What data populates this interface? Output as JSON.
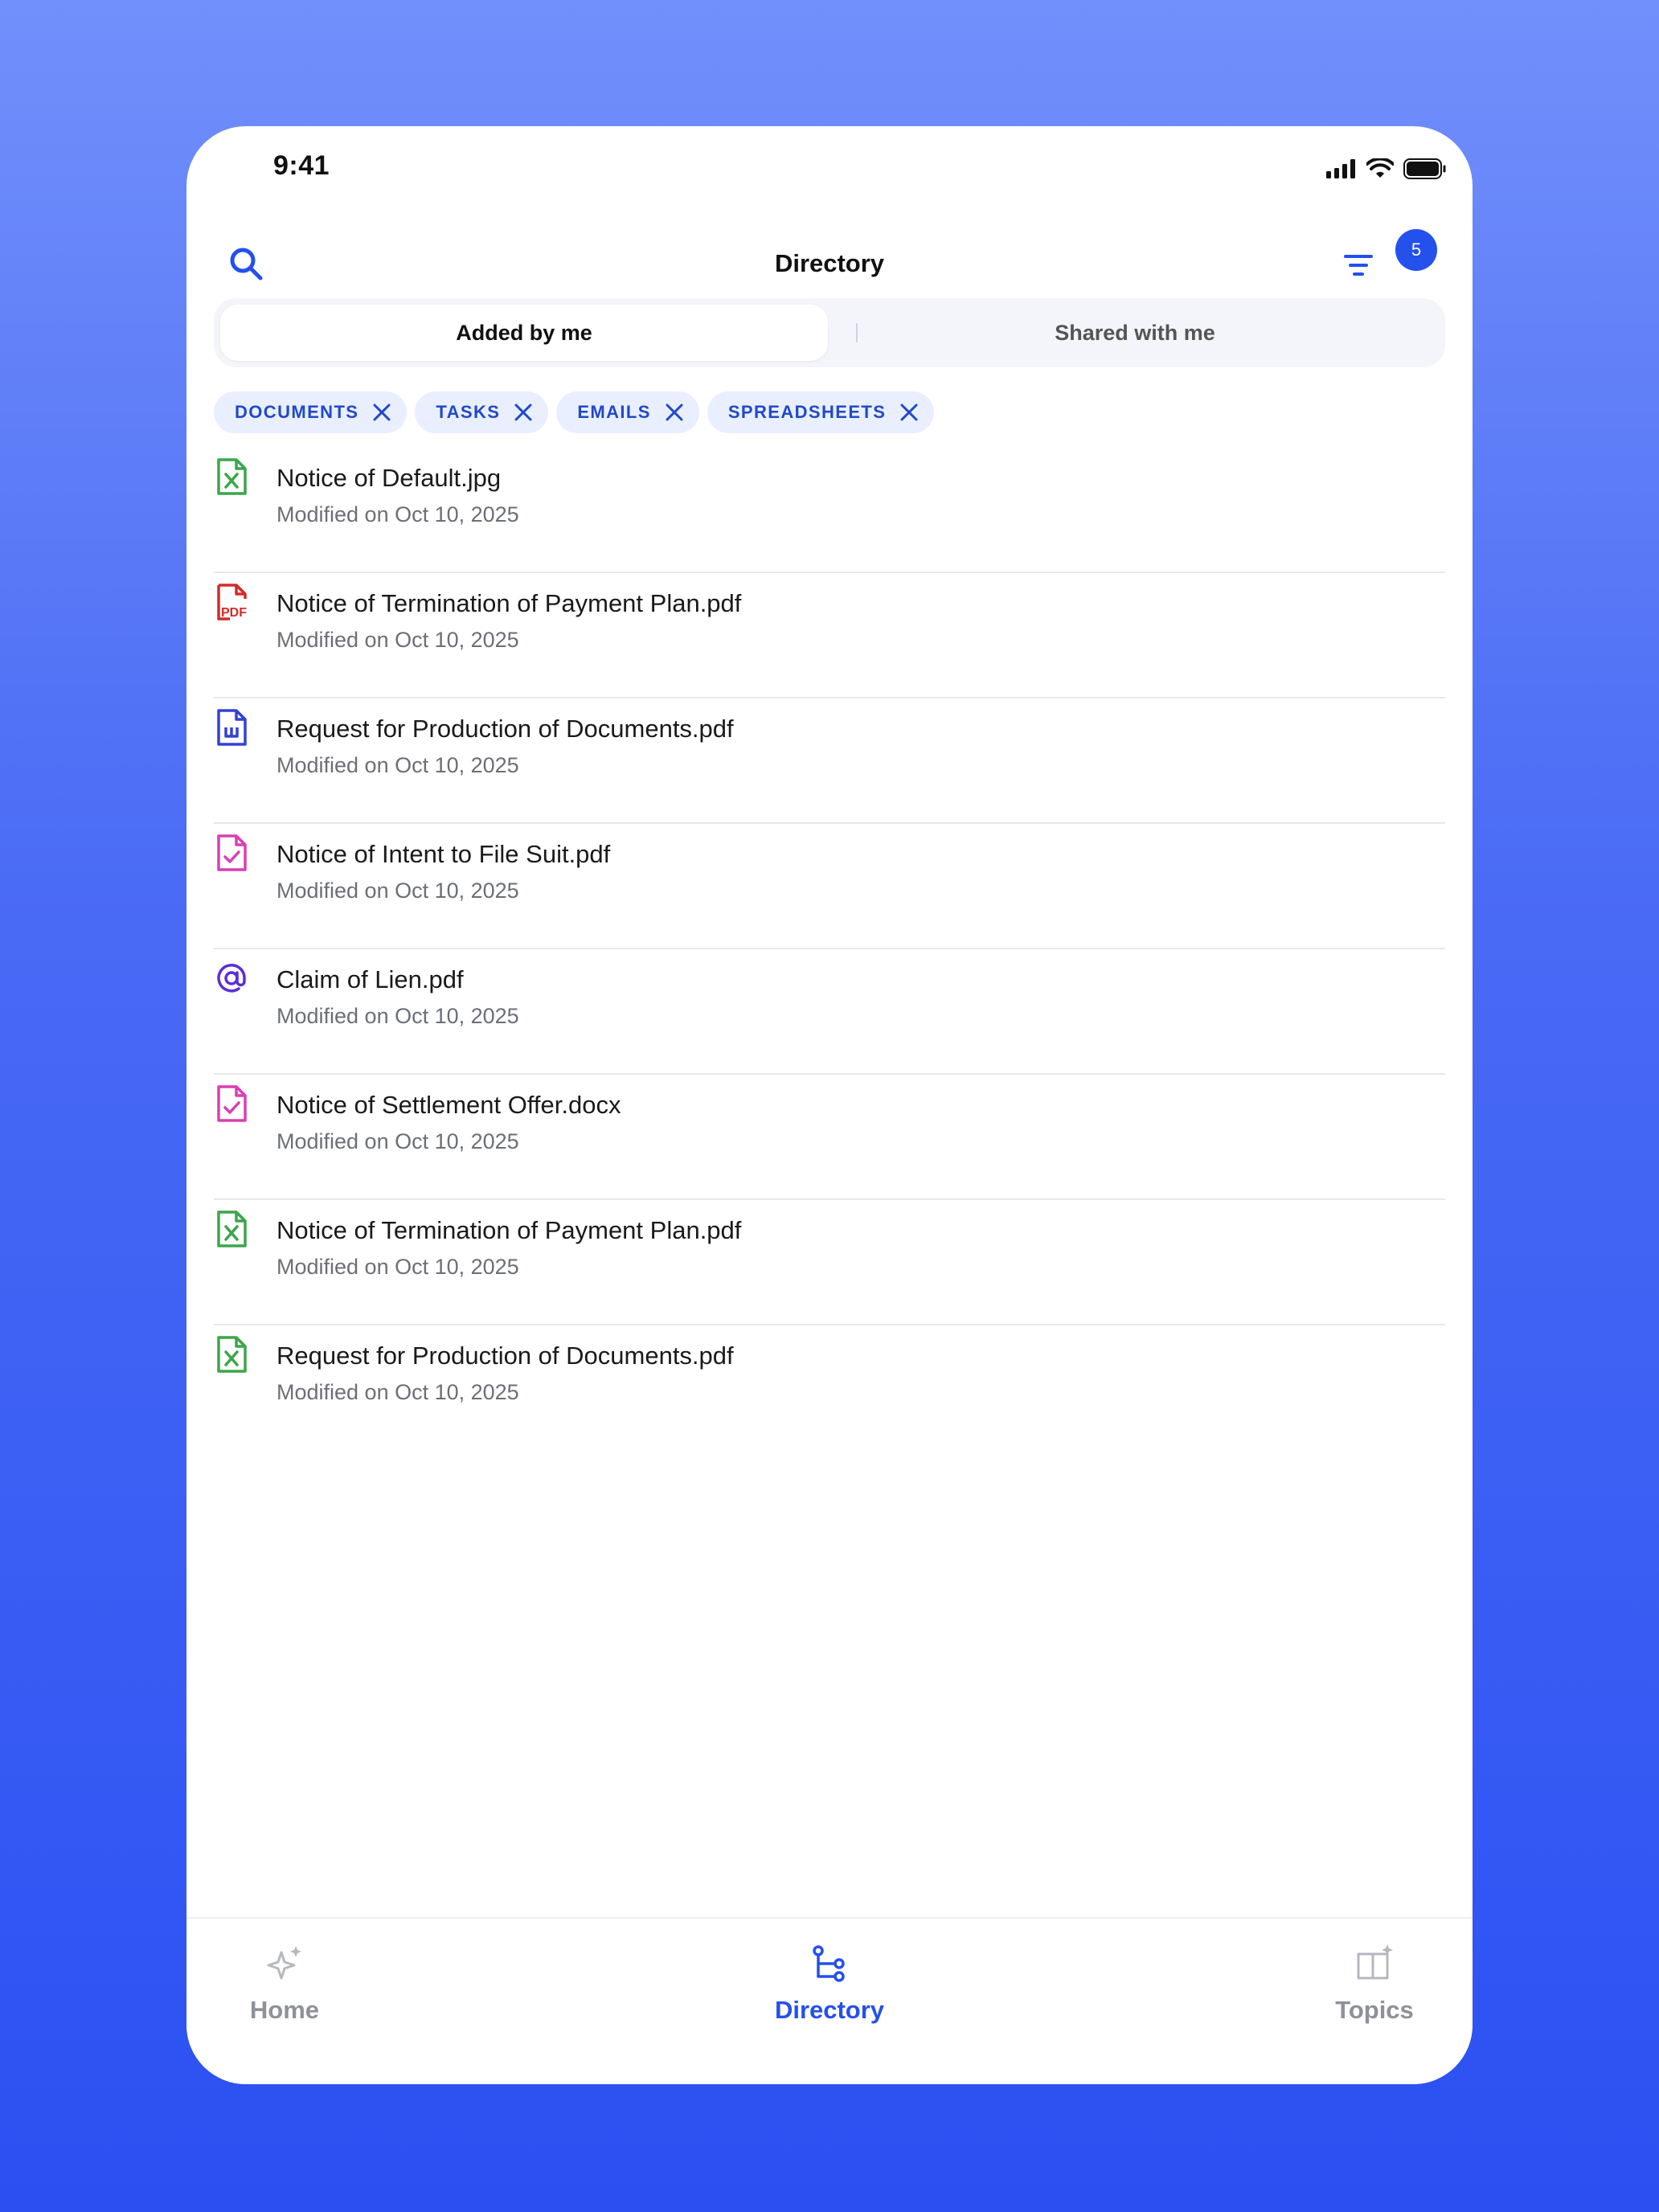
{
  "status_bar": {
    "time": "9:41"
  },
  "header": {
    "title": "Directory",
    "filter_count": "5"
  },
  "segments": [
    {
      "label": "Added by me"
    },
    {
      "label": "Shared with me"
    }
  ],
  "chips": [
    {
      "label": "DOCUMENTS"
    },
    {
      "label": "TASKS"
    },
    {
      "label": "EMAILS"
    },
    {
      "label": "SPREADSHEETS"
    }
  ],
  "files": [
    {
      "name": "Notice of Default.jpg",
      "meta": "Modified on Oct 10, 2025",
      "icon": "spreadsheet-icon"
    },
    {
      "name": "Notice of Termination of Payment Plan.pdf",
      "meta": "Modified on Oct 10, 2025",
      "icon": "pdf-icon"
    },
    {
      "name": "Request for Production of Documents.pdf",
      "meta": "Modified on Oct 10, 2025",
      "icon": "word-doc-icon"
    },
    {
      "name": "Notice of Intent to File Suit.pdf",
      "meta": "Modified on Oct 10, 2025",
      "icon": "task-doc-icon"
    },
    {
      "name": "Claim of Lien.pdf",
      "meta": "Modified on Oct 10, 2025",
      "icon": "email-at-icon"
    },
    {
      "name": "Notice of Settlement Offer.docx",
      "meta": "Modified on Oct 10, 2025",
      "icon": "task-doc-icon"
    },
    {
      "name": "Notice of Termination of Payment Plan.pdf",
      "meta": "Modified on Oct 10, 2025",
      "icon": "spreadsheet-icon"
    },
    {
      "name": "Request for Production of Documents.pdf",
      "meta": "Modified on Oct 10, 2025",
      "icon": "spreadsheet-icon"
    }
  ],
  "tab_bar": {
    "home": "Home",
    "directory": "Directory",
    "topics": "Topics"
  },
  "colors": {
    "accent": "#2450ec",
    "spreadsheet": "#3aa64a",
    "pdf": "#d42a2a",
    "word": "#3341d6",
    "task": "#d93fb4",
    "email": "#5b2fd6"
  }
}
